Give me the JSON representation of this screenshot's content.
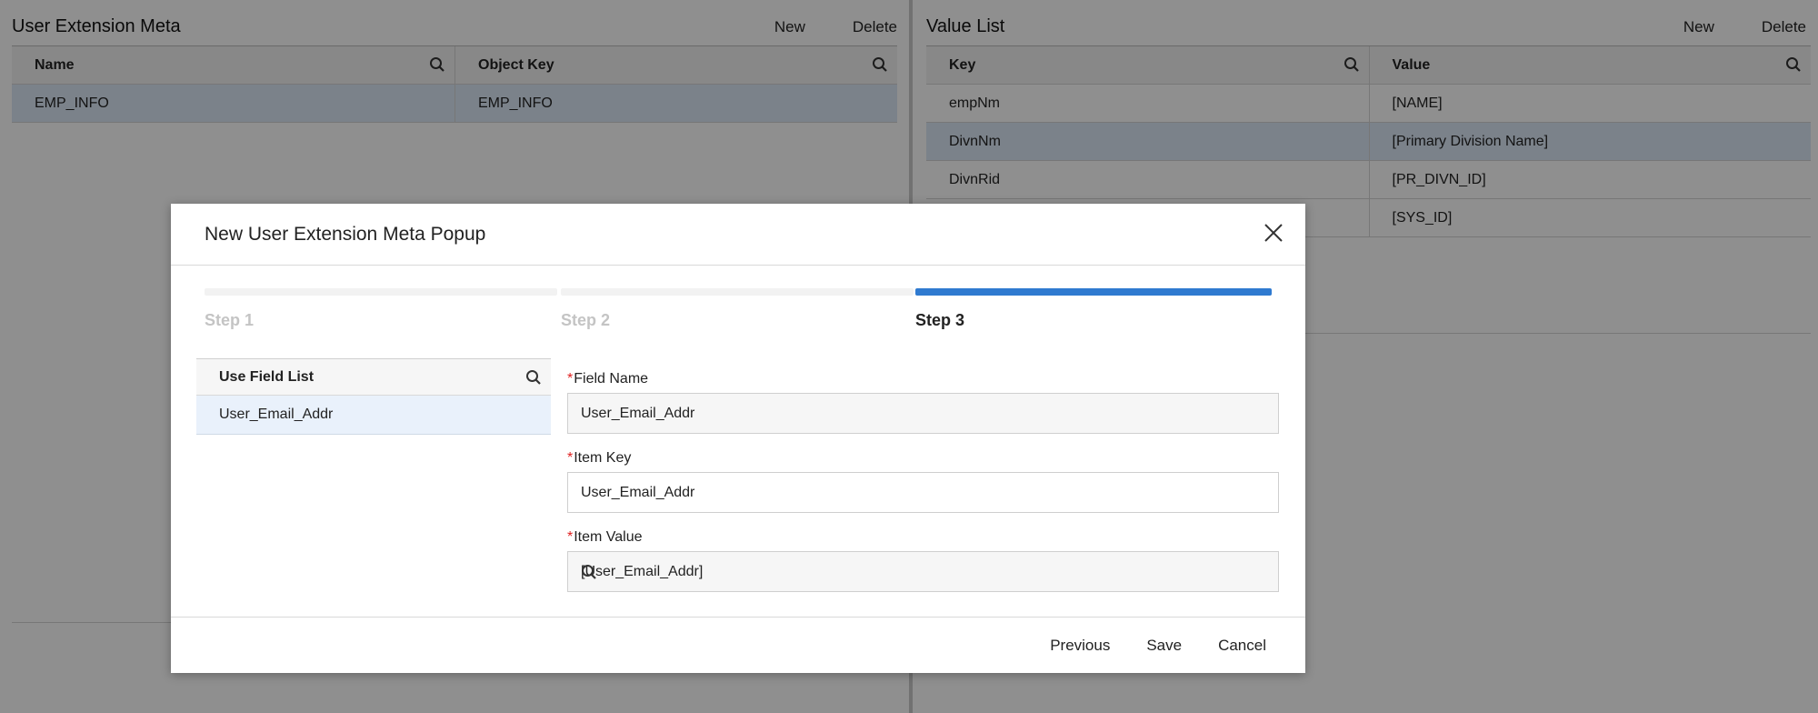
{
  "left_panel": {
    "title": "User Extension Meta",
    "actions": [
      "New",
      "Delete"
    ],
    "columns": [
      "Name",
      "Object Key"
    ],
    "rows": [
      {
        "name": "EMP_INFO",
        "object_key": "EMP_INFO"
      }
    ]
  },
  "right_panel": {
    "title": "Value List",
    "actions": [
      "New",
      "Delete"
    ],
    "columns": [
      "Key",
      "Value"
    ],
    "rows": [
      {
        "key": "empNm",
        "value": "[NAME]"
      },
      {
        "key": "DivnNm",
        "value": "[Primary Division Name]"
      },
      {
        "key": "DivnRid",
        "value": "[PR_DIVN_ID]"
      },
      {
        "key": "",
        "value": "[SYS_ID]"
      }
    ]
  },
  "modal": {
    "title": "New User Extension Meta Popup",
    "steps": [
      {
        "label": "Step 1",
        "active": false
      },
      {
        "label": "Step 2",
        "active": false
      },
      {
        "label": "Step 3",
        "active": true
      }
    ],
    "field_list": {
      "header": "Use Field List",
      "items": [
        "User_Email_Addr"
      ]
    },
    "form": {
      "required_mark": "*",
      "field_name": {
        "label": "Field Name",
        "value": "User_Email_Addr"
      },
      "item_key": {
        "label": "Item Key",
        "value": "User_Email_Addr"
      },
      "item_value": {
        "label": "Item Value",
        "value": "[User_Email_Addr]"
      }
    },
    "buttons": {
      "previous": "Previous",
      "save": "Save",
      "cancel": "Cancel"
    }
  },
  "colors": {
    "accent": "#2f7ad0",
    "required": "#e02020",
    "selected_row": "#dce8f7",
    "overlay": "rgba(0,0,0,0.44)"
  }
}
